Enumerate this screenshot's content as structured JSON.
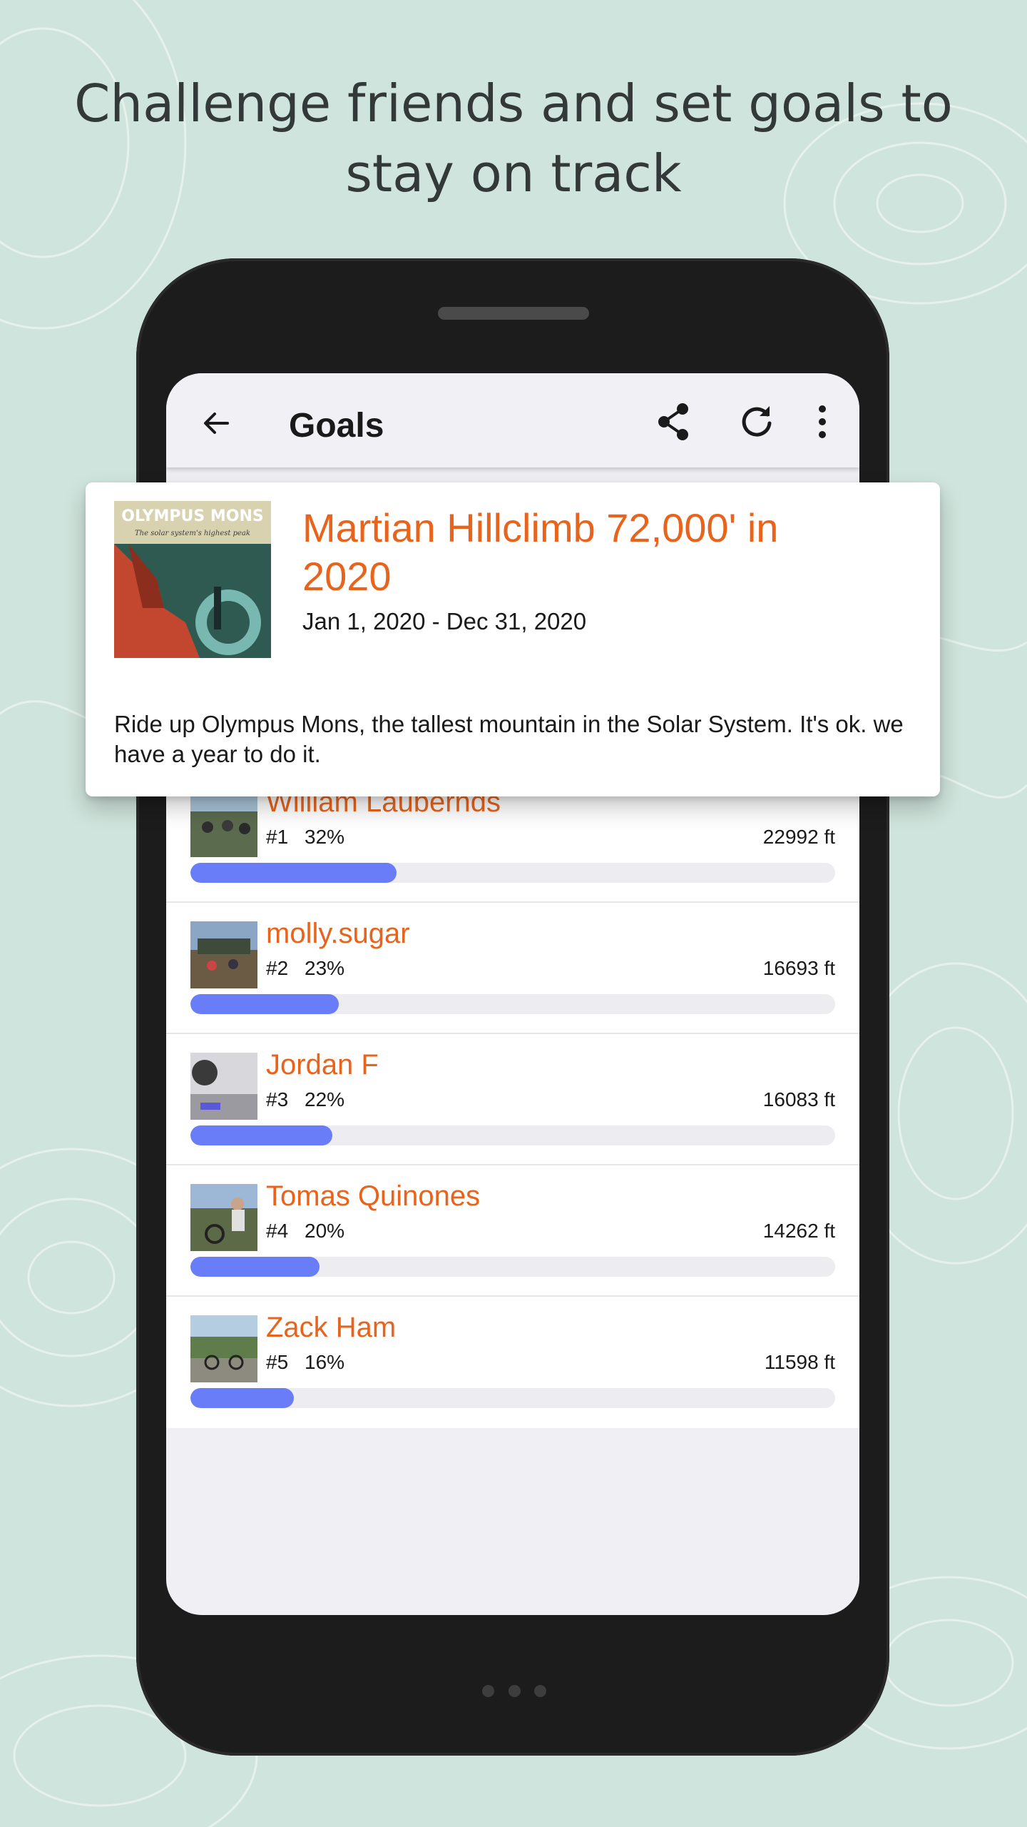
{
  "headline": "Challenge friends and set goals to stay on track",
  "appbar": {
    "title": "Goals",
    "icons": {
      "back": "arrow-left-icon",
      "share": "share-icon",
      "refresh": "refresh-icon",
      "more": "more-vertical-icon"
    }
  },
  "goal": {
    "title": "Martian Hillclimb 72,000' in 2020",
    "dates": "Jan 1, 2020 - Dec 31, 2020",
    "description": "Ride up Olympus Mons, the tallest mountain in the Solar System. It's ok. we have a year to do it.",
    "poster_text": "OLYMPUS MONS",
    "poster_tagline": "The solar system's highest peak"
  },
  "leaderboard": [
    {
      "name": "William Laubernds",
      "rank": "#1",
      "percent": "32%",
      "progress": 0.32,
      "distance": "22992 ft"
    },
    {
      "name": "molly.sugar",
      "rank": "#2",
      "percent": "23%",
      "progress": 0.23,
      "distance": "16693 ft"
    },
    {
      "name": "Jordan F",
      "rank": "#3",
      "percent": "22%",
      "progress": 0.22,
      "distance": "16083 ft"
    },
    {
      "name": "Tomas Quinones",
      "rank": "#4",
      "percent": "20%",
      "progress": 0.2,
      "distance": "14262 ft"
    },
    {
      "name": "Zack Ham",
      "rank": "#5",
      "percent": "16%",
      "progress": 0.16,
      "distance": "11598 ft"
    }
  ],
  "colors": {
    "accent": "#e8641c",
    "progress": "#6a7df8",
    "background": "#cfe4dc"
  }
}
